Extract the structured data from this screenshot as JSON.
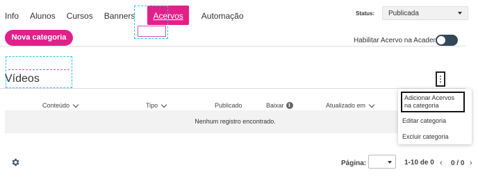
{
  "nav": {
    "tabs": [
      {
        "label": "Info"
      },
      {
        "label": "Alunos"
      },
      {
        "label": "Cursos"
      },
      {
        "label": "Banners"
      },
      {
        "label": "Acervos",
        "active": true
      },
      {
        "label": "Automação"
      }
    ]
  },
  "status": {
    "label": "Status:",
    "value": "Publicada"
  },
  "toolbar": {
    "new_category_label": "Nova categoria",
    "enable_label": "Habilitar Acervo na Academia",
    "enable_on": true
  },
  "section": {
    "title": "Vídeos"
  },
  "table": {
    "columns": {
      "conteudo": "Conteúdo",
      "tipo": "Tipo",
      "publicado": "Publicado",
      "baixar": "Baixar",
      "atualizado": "Atualizado em"
    },
    "empty_message": "Nenhum registro encontrado."
  },
  "menu": {
    "items": [
      {
        "label": "Adicionar Acervos na categoria"
      },
      {
        "label": "Editar categoria"
      },
      {
        "label": "Excluir categoria"
      }
    ]
  },
  "pagination": {
    "label": "Página:",
    "range": "1-10 de 0",
    "prev": "‹",
    "count": "0 / 0",
    "next": "›"
  },
  "colors": {
    "accent": "#e1218a",
    "toggle": "#33475b"
  },
  "icons": [
    "settings-gear-icon",
    "kebab-menu-icon",
    "info-icon",
    "chevron-down-icon"
  ]
}
